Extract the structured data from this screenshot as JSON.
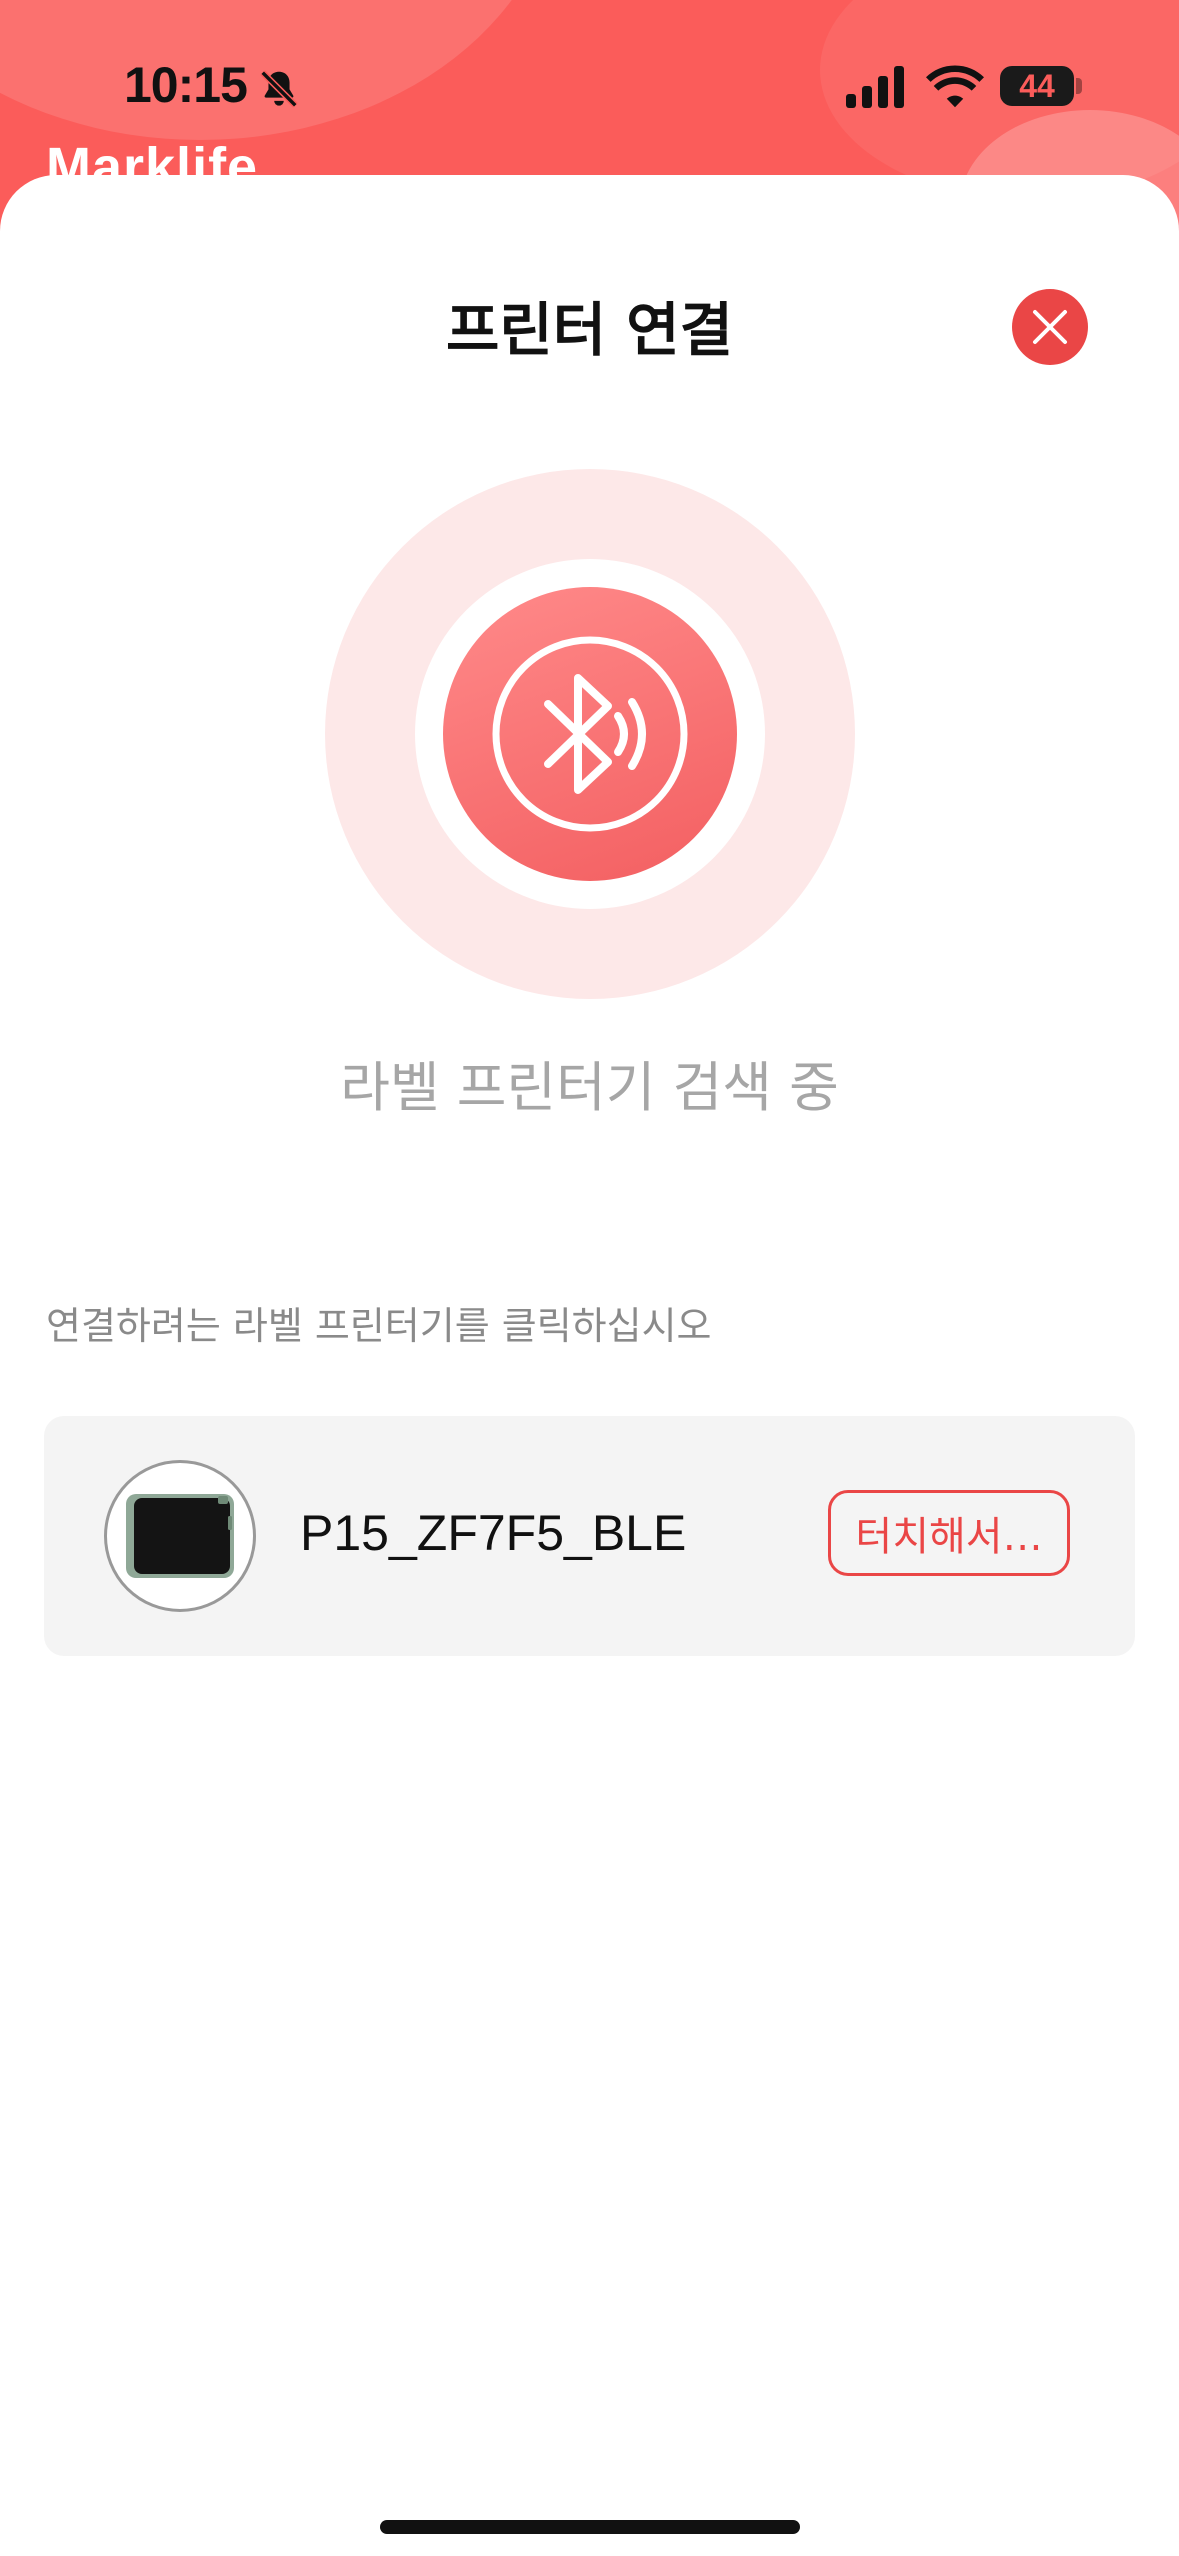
{
  "status_bar": {
    "time": "10:15",
    "battery_level": "44",
    "icons": [
      "bell-slash-icon",
      "cellular-signal-icon",
      "wifi-icon",
      "battery-icon"
    ]
  },
  "app": {
    "title": "Marklife"
  },
  "sheet": {
    "title": "프린터 연결",
    "close_icon": "close-icon",
    "scanning_icon": "bluetooth-scan-icon",
    "searching_text": "라벨 프린터기 검색 중",
    "instruction": "연결하려는 라벨 프린터기를 클릭하십시오",
    "devices": [
      {
        "name": "P15_ZF7F5_BLE",
        "action_label": "터치해서…",
        "thumb_icon": "printer-device-image"
      }
    ]
  },
  "colors": {
    "accent": "#ea4646",
    "header": "#fb5c5a",
    "scan_ring": "#fde8e8",
    "scan_core": "#f35f61",
    "row_background": "#f4f4f4"
  }
}
